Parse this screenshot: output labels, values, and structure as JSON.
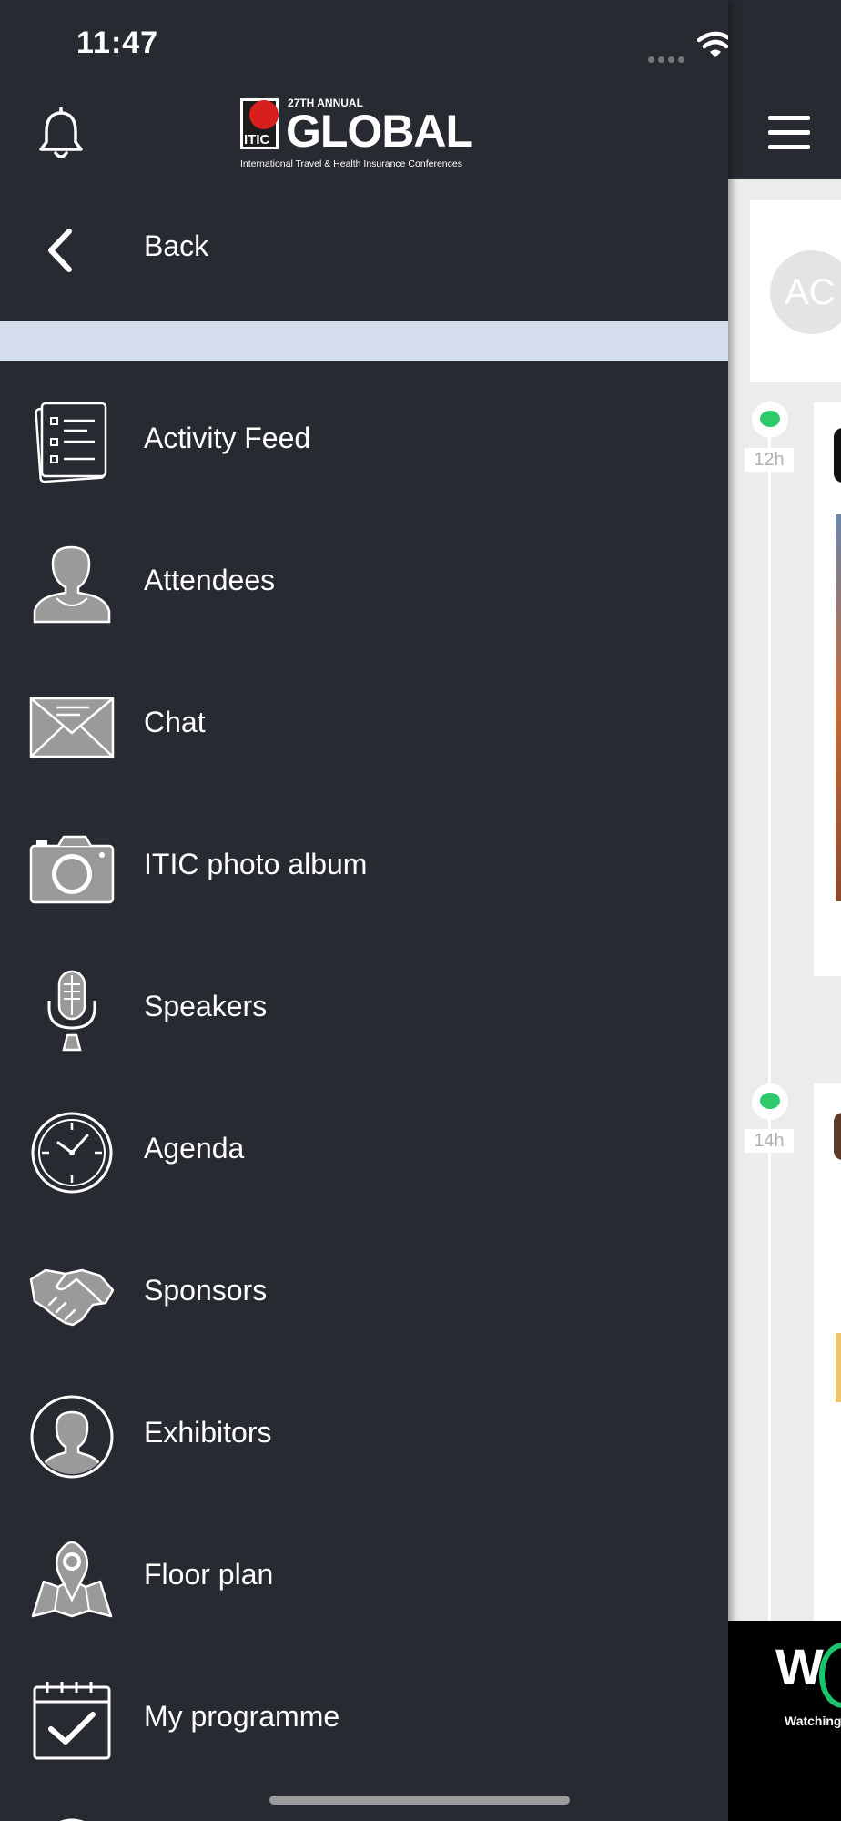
{
  "status_bar": {
    "time": "11:47"
  },
  "header": {
    "logo": {
      "mark_text": "ITIC",
      "annual_text": "27TH ANNUAL",
      "title": "GLOBAL",
      "subtitle": "International Travel & Health Insurance Conferences"
    }
  },
  "back": {
    "label": "Back"
  },
  "menu": {
    "items": [
      {
        "label": "Activity Feed",
        "icon": "activity-feed-icon"
      },
      {
        "label": "Attendees",
        "icon": "person-icon"
      },
      {
        "label": "Chat",
        "icon": "envelope-icon"
      },
      {
        "label": "ITIC photo album",
        "icon": "camera-icon"
      },
      {
        "label": "Speakers",
        "icon": "microphone-icon"
      },
      {
        "label": "Agenda",
        "icon": "clock-icon"
      },
      {
        "label": "Sponsors",
        "icon": "handshake-icon"
      },
      {
        "label": "Exhibitors",
        "icon": "person-circle-icon"
      },
      {
        "label": "Floor plan",
        "icon": "map-pin-icon"
      },
      {
        "label": "My programme",
        "icon": "calendar-check-icon"
      }
    ]
  },
  "background_screen": {
    "avatar_initials": "AC",
    "feed_times": [
      "12h",
      "14h"
    ],
    "banner_text": "Watching",
    "banner_logo": "W"
  },
  "colors": {
    "drawer_bg": "#272b31",
    "divider_band": "#d3ddeb",
    "icon_fill": "#9a9a9a",
    "accent_green": "#2ec96a"
  }
}
